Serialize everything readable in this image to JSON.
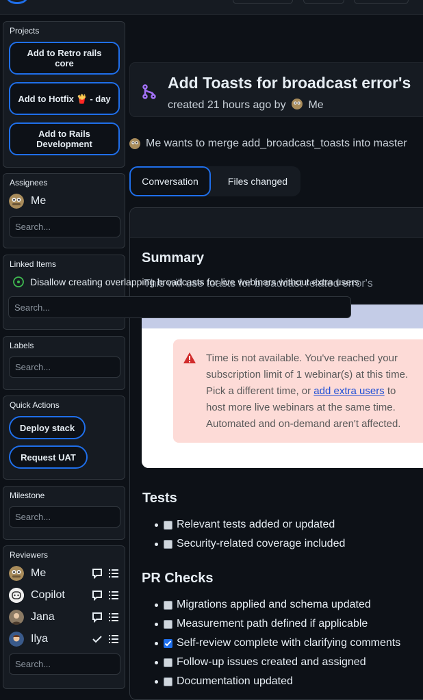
{
  "sidebar": {
    "projects": {
      "title": "Projects",
      "buttons": [
        "Add to Retro rails core",
        "Add to Hotfix 🍟 - day",
        "Add to Rails Development"
      ]
    },
    "assignees": {
      "title": "Assignees",
      "name": "Me",
      "search_placeholder": "Search..."
    },
    "linked_items": {
      "title": "Linked Items",
      "item": "Disallow creating overlapping broadcasts for live webinars without extra users",
      "search_placeholder": "Search..."
    },
    "labels": {
      "title": "Labels",
      "search_placeholder": "Search..."
    },
    "quick_actions": {
      "title": "Quick Actions",
      "buttons": [
        "Deploy stack",
        "Request UAT"
      ]
    },
    "milestone": {
      "title": "Milestone",
      "search_placeholder": "Search..."
    },
    "reviewers": {
      "title": "Reviewers",
      "people": [
        {
          "name": "Me",
          "status": "commented"
        },
        {
          "name": "Copilot",
          "status": "commented"
        },
        {
          "name": "Jana",
          "status": "commented"
        },
        {
          "name": "Ilya",
          "status": "approved"
        }
      ],
      "search_placeholder": "Search..."
    }
  },
  "pr": {
    "title": "Add Toasts for broadcast error's",
    "created_prefix": "created 21 hours ago by",
    "author": "Me",
    "merge_text": "Me wants to merge add_broadcast_toasts into master"
  },
  "tabs": [
    {
      "label": "Conversation",
      "active": true
    },
    {
      "label": "Files changed",
      "active": false
    }
  ],
  "body": {
    "summary_heading": "Summary",
    "summary_text": "This will use toasts for broadcast related error's",
    "alert": {
      "line1": "Time is not available. You've reached your",
      "line2": "subscription limit of 1 webinar(s) at this time.",
      "line3_pre": "Pick a different time, or ",
      "line3_link": "add extra users",
      "line3_post": " to",
      "line4": "host more live webinars at the same time.",
      "line5": "Automated and on-demand aren't affected."
    },
    "tests_heading": "Tests",
    "tests": [
      {
        "label": "Relevant tests added or updated",
        "checked": false
      },
      {
        "label": "Security-related coverage included",
        "checked": false
      }
    ],
    "checks_heading": "PR Checks",
    "checks": [
      {
        "label": "Migrations applied and schema updated",
        "checked": false
      },
      {
        "label": "Measurement path defined if applicable",
        "checked": false
      },
      {
        "label": "Self-review complete with clarifying comments",
        "checked": true
      },
      {
        "label": "Follow-up issues created and assigned",
        "checked": false
      },
      {
        "label": "Documentation updated",
        "checked": false
      }
    ]
  },
  "colors": {
    "accent": "#1f6feb",
    "merge_icon": "#a371f7",
    "open_issue": "#3fb950",
    "bg": "#0d1117"
  }
}
